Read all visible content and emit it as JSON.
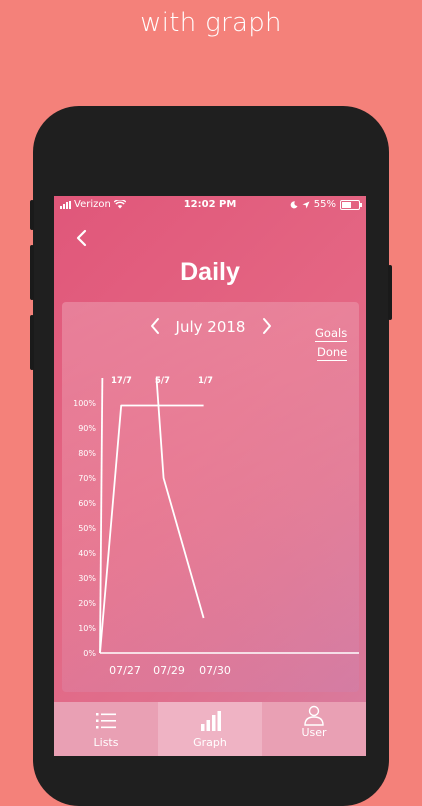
{
  "headline": "with graph",
  "status_bar": {
    "carrier": "Verizon",
    "time": "12:02 PM",
    "battery_percent": "55%",
    "battery_level": 0.55
  },
  "header": {
    "title": "Daily",
    "back_icon": "chevron-left-icon"
  },
  "calendar": {
    "month": "July 2018",
    "prev_icon": "chevron-left-icon",
    "next_icon": "chevron-right-icon"
  },
  "links": {
    "goals": "Goals",
    "done": "Done"
  },
  "tabs": [
    {
      "label": "Lists",
      "icon": "list-icon",
      "active": false
    },
    {
      "label": "Graph",
      "icon": "bar-chart-icon",
      "active": true
    },
    {
      "label": "User",
      "icon": "user-icon",
      "active": false
    }
  ],
  "colors": {
    "background": "#f4817a",
    "screen_accent": "#e0577a",
    "tab_bar": "#e9a0b4",
    "active_tab": "#efb3c4"
  },
  "chart_data": {
    "type": "line",
    "x_tick_labels": [
      "07/27",
      "07/29",
      "07/30"
    ],
    "y_tick_labels": [
      "0%",
      "10%",
      "20%",
      "30%",
      "40%",
      "50%",
      "60%",
      "70%",
      "80%",
      "90%",
      "100%"
    ],
    "ylim": [
      0,
      100
    ],
    "annotations": [
      "17/7",
      "5/7",
      "1/7"
    ],
    "series": [
      {
        "points": [
          [
            0,
            0
          ],
          [
            0.05,
            110
          ]
        ]
      },
      {
        "points": [
          [
            0,
            0
          ],
          [
            0.45,
            99
          ],
          [
            2.2,
            99
          ]
        ]
      },
      {
        "points": [
          [
            1.2,
            110
          ],
          [
            1.35,
            70
          ],
          [
            2.2,
            14
          ]
        ]
      }
    ],
    "xlim": [
      0,
      5.5
    ],
    "grid": false
  }
}
